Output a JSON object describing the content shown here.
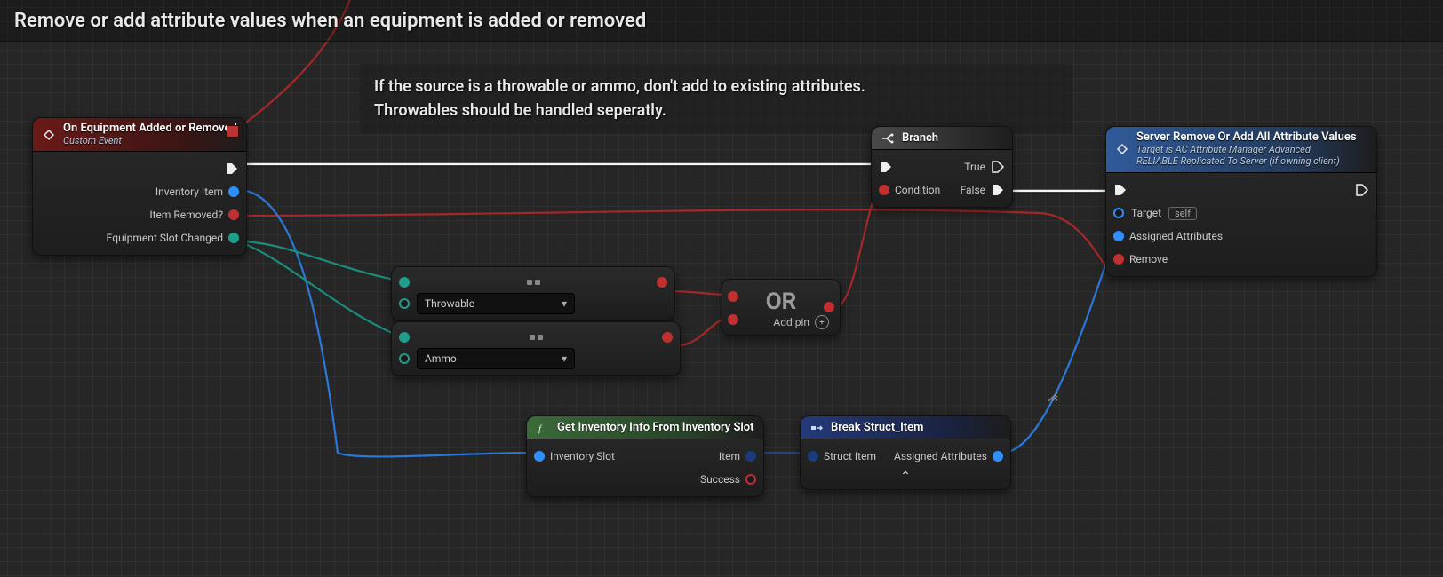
{
  "title": "Remove or add attribute values when an equipment is added or removed",
  "comment": {
    "line1": "If the source is a throwable or ammo, don't add to existing attributes.",
    "line2": "Throwables should be handled seperatly."
  },
  "nodes": {
    "event": {
      "title": "On Equipment Added or Removed",
      "subtitle": "Custom Event",
      "pins": {
        "inventory_item": "Inventory Item",
        "item_removed": "Item Removed?",
        "equipment_slot_changed": "Equipment Slot Changed"
      }
    },
    "equal1": {
      "option": "Throwable"
    },
    "equal2": {
      "option": "Ammo"
    },
    "or": {
      "label": "OR",
      "add_pin": "Add pin"
    },
    "branch": {
      "title": "Branch",
      "pins": {
        "condition": "Condition",
        "true": "True",
        "false": "False"
      }
    },
    "getinv": {
      "title": "Get Inventory Info From Inventory Slot",
      "pins": {
        "inventory_slot": "Inventory Slot",
        "item": "Item",
        "success": "Success"
      }
    },
    "break": {
      "title": "Break Struct_Item",
      "pins": {
        "struct_item": "Struct Item",
        "assigned_attributes": "Assigned Attributes"
      }
    },
    "server": {
      "title": "Server Remove Or Add All Attribute Values",
      "sub1": "Target is AC Attribute Manager Advanced",
      "sub2": "RELIABLE Replicated To Server (if owning client)",
      "pins": {
        "target": "Target",
        "target_default": "self",
        "assigned_attributes": "Assigned Attributes",
        "remove": "Remove"
      }
    }
  }
}
